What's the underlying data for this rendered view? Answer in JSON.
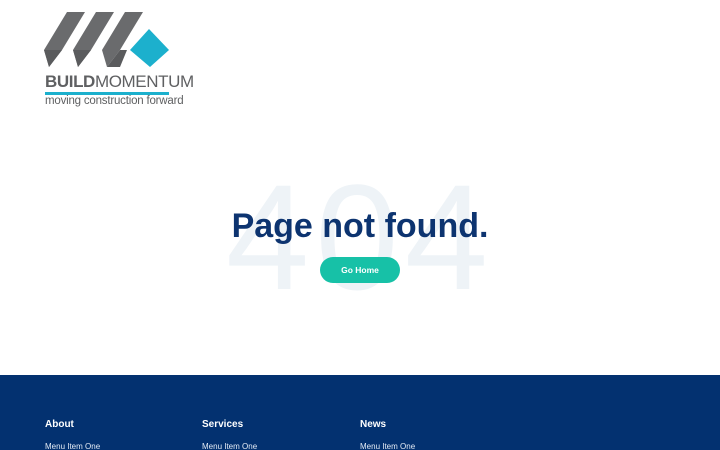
{
  "brand": {
    "name_bold": "BUILD",
    "name_light": "MOMENTUM",
    "tagline": "moving construction forward",
    "colors": {
      "dark": "#5f6062",
      "accent": "#1cb0cd"
    }
  },
  "error": {
    "code": "404",
    "title": "Page not found.",
    "button_label": "Go Home"
  },
  "footer": {
    "columns": [
      {
        "title": "About",
        "items": [
          "Menu Item One"
        ]
      },
      {
        "title": "Services",
        "items": [
          "Menu Item One"
        ]
      },
      {
        "title": "News",
        "items": [
          "Menu Item One"
        ]
      }
    ]
  },
  "colors": {
    "title": "#0d3470",
    "button": "#17c1a7",
    "footer_bg": "#033170",
    "ghost_404": "#eef3f7"
  }
}
